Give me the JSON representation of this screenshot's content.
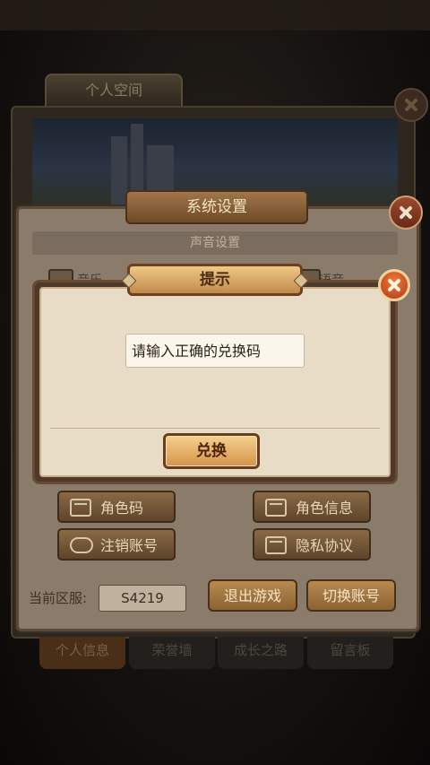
{
  "background": {
    "personal_tab": "个人空间",
    "bottom_tabs": [
      "个人信息",
      "荣誉墙",
      "成长之路",
      "留言板"
    ]
  },
  "settings": {
    "title": "系统设置",
    "sound_header": "声音设置",
    "music_label": "音乐",
    "voice_label": "语音",
    "buttons": {
      "role_code": "角色码",
      "role_info": "角色信息",
      "cancel_account": "注销账号",
      "privacy": "隐私协议",
      "logout": "退出游戏",
      "switch_account": "切换账号"
    },
    "server_label": "当前区服:",
    "server_value": "S4219"
  },
  "dialog": {
    "title": "提示",
    "message": "请输入正确的兑换码",
    "confirm_label": "兑换"
  },
  "colors": {
    "dialog_bg": "#e9dcc6",
    "accent_gold": "#d5924a",
    "close_red": "#b03a14"
  }
}
